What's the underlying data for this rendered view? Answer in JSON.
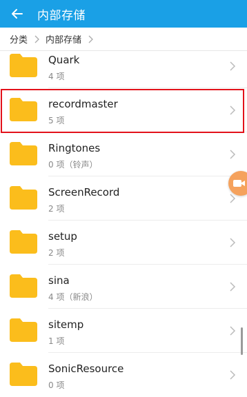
{
  "header": {
    "title": "内部存储"
  },
  "breadcrumb": {
    "items": [
      "分类",
      "内部存储"
    ]
  },
  "folders": [
    {
      "name": "Quark",
      "meta": "4 项"
    },
    {
      "name": "recordmaster",
      "meta": "5 项"
    },
    {
      "name": "Ringtones",
      "meta": "0 项（铃声）"
    },
    {
      "name": "ScreenRecord",
      "meta": "2 项"
    },
    {
      "name": "setup",
      "meta": "2 项"
    },
    {
      "name": "sina",
      "meta": "4 项（新浪）"
    },
    {
      "name": "sitemp",
      "meta": "1 项"
    },
    {
      "name": "SonicResource",
      "meta": "0 项"
    }
  ],
  "colors": {
    "appbar": "#1aa0e6",
    "folder": "#fbbd1c",
    "highlight": "#e3111a",
    "floating_button": "#f5a25d"
  },
  "icons": {
    "back": "back-arrow-icon",
    "folder": "folder-icon",
    "chevron": "chevron-right-icon",
    "floating": "screen-record-icon"
  }
}
